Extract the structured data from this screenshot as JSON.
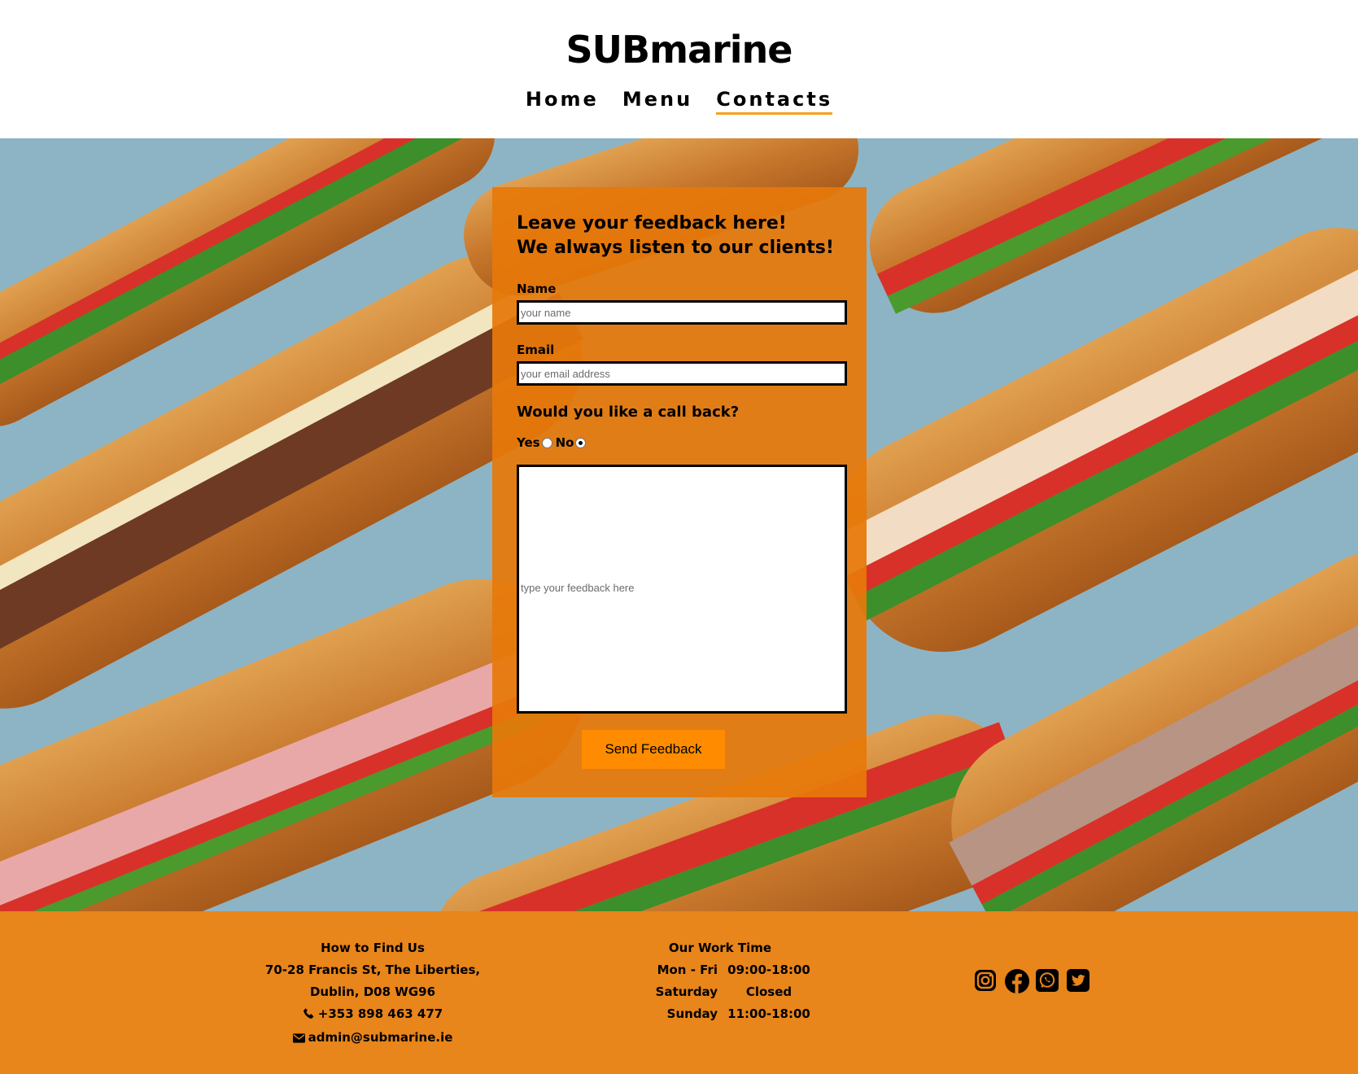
{
  "header": {
    "logo": "SUBmarine",
    "nav": [
      {
        "label": "Home",
        "active": false
      },
      {
        "label": "Menu",
        "active": false
      },
      {
        "label": "Contacts",
        "active": true
      }
    ],
    "active_underline_color": "#f5a21b"
  },
  "feedback_form": {
    "title_line1": "Leave your feedback here!",
    "title_line2": "We always listen to our clients!",
    "name_label": "Name",
    "name_placeholder": "your name",
    "email_label": "Email",
    "email_placeholder": "your email address",
    "callback_question": "Would you like a call back?",
    "yes_label": "Yes",
    "no_label": "No",
    "selected_option": "No",
    "feedback_placeholder": "type your feedback here",
    "submit_label": "Send Feedback",
    "panel_color": "#e6780a",
    "button_color": "#ff8c00"
  },
  "footer": {
    "find_us": {
      "heading": "How to Find Us",
      "address_line1": "70-28 Francis St, The Liberties,",
      "address_line2": "Dublin, D08 WG96",
      "phone": "+353 898 463 477",
      "email": "admin@submarine.ie"
    },
    "work_time": {
      "heading": "Our Work Time",
      "rows": [
        {
          "day": "Mon - Fri",
          "time": "09:00-18:00"
        },
        {
          "day": "Saturday",
          "time": "Closed"
        },
        {
          "day": "Sunday",
          "time": "11:00-18:00"
        }
      ]
    },
    "social_icons": [
      "instagram-icon",
      "facebook-icon",
      "whatsapp-icon",
      "twitter-icon"
    ],
    "background_color": "#e8851b"
  }
}
